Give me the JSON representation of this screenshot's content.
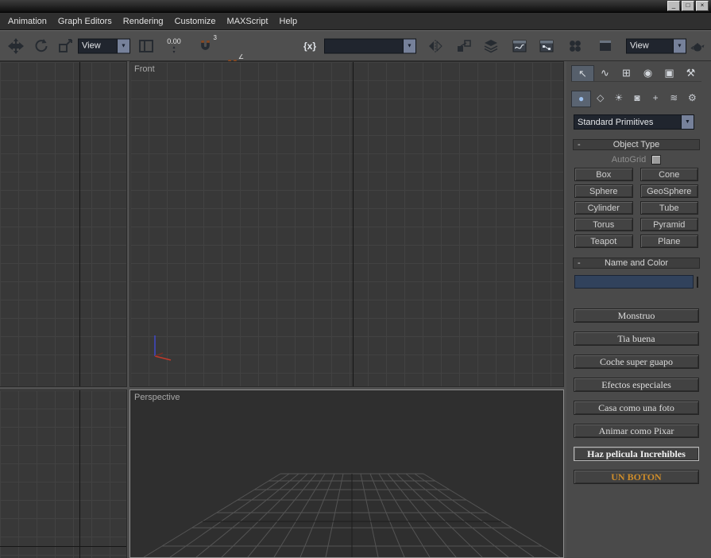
{
  "window": {
    "controls": [
      {
        "name": "minimize",
        "glyph": "_"
      },
      {
        "name": "restore",
        "glyph": "□"
      },
      {
        "name": "close",
        "glyph": "×"
      }
    ]
  },
  "menu": {
    "items": [
      "Animation",
      "Graph Editors",
      "Rendering",
      "Customize",
      "MAXScript",
      "Help"
    ]
  },
  "toolbar": {
    "view_combo_value": "View",
    "offset_spinner_value": "0.00",
    "snap_badges": [
      "3",
      "∠",
      "%",
      "⇅"
    ],
    "selection_brackets_label": "{x}",
    "named_sets_value": "",
    "render_view_combo_value": "View"
  },
  "viewports": {
    "front_label": "Front",
    "perspective_label": "Perspective"
  },
  "command_panel": {
    "tabs": [
      {
        "name": "create",
        "glyph": "↖"
      },
      {
        "name": "modify",
        "glyph": "∿"
      },
      {
        "name": "hierarchy",
        "glyph": "⊞"
      },
      {
        "name": "motion",
        "glyph": "◉"
      },
      {
        "name": "display",
        "glyph": "▣"
      },
      {
        "name": "utilities",
        "glyph": "⚒"
      }
    ],
    "categories": [
      {
        "name": "geometry",
        "glyph": "●"
      },
      {
        "name": "shapes",
        "glyph": "◇"
      },
      {
        "name": "lights",
        "glyph": "☀"
      },
      {
        "name": "cameras",
        "glyph": "◙"
      },
      {
        "name": "helpers",
        "glyph": "+"
      },
      {
        "name": "space-warps",
        "glyph": "≋"
      },
      {
        "name": "systems",
        "glyph": "⚙"
      }
    ],
    "subcategory_dropdown_value": "Standard Primitives",
    "object_type_rollout": {
      "collapse_glyph": "-",
      "title": "Object Type",
      "autogrid_label": "AutoGrid",
      "primitives": [
        "Box",
        "Cone",
        "Sphere",
        "GeoSphere",
        "Cylinder",
        "Tube",
        "Torus",
        "Pyramid",
        "Teapot",
        "Plane"
      ]
    },
    "name_color_rollout": {
      "collapse_glyph": "-",
      "title": "Name and Color",
      "name_value": "",
      "swatch_color": "#a21345"
    },
    "custom_buttons": [
      {
        "label": "Monstruo"
      },
      {
        "label": "Tia buena"
      },
      {
        "label": "Coche super guapo"
      },
      {
        "label": "Efectos especiales"
      },
      {
        "label": "Casa como una foto"
      },
      {
        "label": "Animar como Pixar"
      },
      {
        "label": "Haz pelicula Increhibles"
      },
      {
        "label": "UN BOTON",
        "text_color": "#cf8d2a"
      }
    ]
  },
  "colors": {
    "toolbar_bg": "#4f4f4f",
    "panel_bg": "#4a4a4a",
    "viewport_bg": "#383838",
    "grid_line": "#424242",
    "name_field_bg": "#31425c",
    "swatch": "#a21345",
    "accent_text": "#cf8d2a"
  }
}
